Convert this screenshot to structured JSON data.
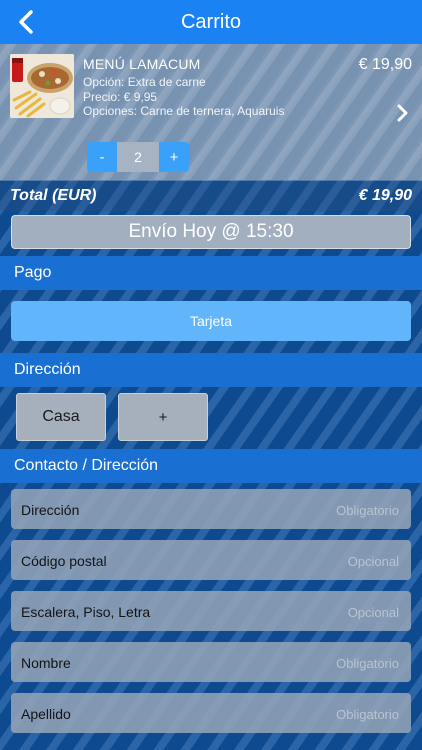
{
  "navbar": {
    "title": "Carrito",
    "back_icon": "chevron-left-icon"
  },
  "cart_item": {
    "name": "MENÚ LAMACUM",
    "option": "Opción: Extra de carne",
    "price_line": "Precio: € 9,95",
    "options_line": "Opciones: Carne de ternera, Aquaruis",
    "total_price": "€ 19,90",
    "quantity": "2",
    "minus_label": "-",
    "plus_label": "+",
    "detail_icon": "chevron-right-icon"
  },
  "total": {
    "label": "Total (EUR)",
    "value": "€ 19,90"
  },
  "shipping": {
    "label": "Envío Hoy @ 15:30"
  },
  "payment": {
    "header": "Pago",
    "method_label": "Tarjeta"
  },
  "address": {
    "header": "Dirección",
    "saved_label": "Casa",
    "add_label": "+"
  },
  "contact": {
    "header": "Contacto / Dirección",
    "fields": [
      {
        "label": "Dirección",
        "placeholder": "Obligatorio",
        "value": ""
      },
      {
        "label": "Código postal",
        "placeholder": "Opcional",
        "value": ""
      },
      {
        "label": "Escalera, Piso, Letra",
        "placeholder": "Opcional",
        "value": ""
      },
      {
        "label": "Nombre",
        "placeholder": "Obligatorio",
        "value": ""
      },
      {
        "label": "Apellido",
        "placeholder": "Obligatorio",
        "value": ""
      }
    ]
  },
  "colors": {
    "navbar": "#1a82f2",
    "section_header": "#1a6fd2",
    "primary_button": "#61b5fb",
    "stepper_button": "#39a1f9"
  }
}
